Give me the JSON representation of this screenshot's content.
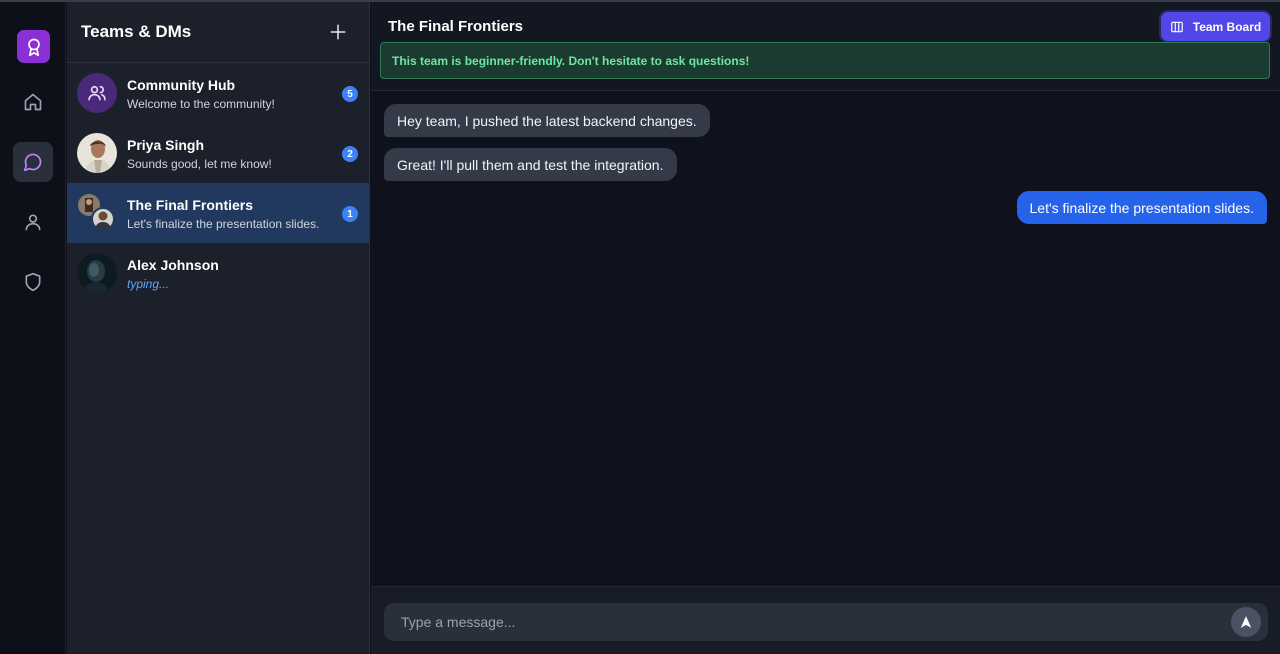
{
  "sidebar_rail": {
    "logo_icon": "award-icon",
    "items": [
      {
        "name": "home",
        "icon": "home-icon",
        "active": false
      },
      {
        "name": "chats",
        "icon": "chat-bubble-icon",
        "active": true
      },
      {
        "name": "profile",
        "icon": "user-icon",
        "active": false
      },
      {
        "name": "security",
        "icon": "shield-icon",
        "active": false
      }
    ]
  },
  "conversations": {
    "title": "Teams & DMs",
    "add_icon": "plus-icon",
    "items": [
      {
        "name": "Community Hub",
        "preview": "Welcome to the community!",
        "unread": "5",
        "active": false
      },
      {
        "name": "Priya Singh",
        "preview": "Sounds good, let me know!",
        "unread": "2",
        "active": false
      },
      {
        "name": "The Final Frontiers",
        "preview": "Let's finalize the presentation slides.",
        "unread": "1",
        "active": true
      },
      {
        "name": "Alex Johnson",
        "preview": "typing...",
        "unread": "",
        "active": false
      }
    ]
  },
  "chat": {
    "title": "The Final Frontiers",
    "team_board_label": "Team Board",
    "notice": "This team is beginner-friendly. Don't hesitate to ask questions!",
    "messages": [
      {
        "direction": "in",
        "text": "Hey team, I pushed the latest backend changes."
      },
      {
        "direction": "in",
        "text": "Great! I'll pull them and test the integration."
      },
      {
        "direction": "out",
        "text": "Let's finalize the presentation slides."
      }
    ],
    "composer": {
      "placeholder": "Type a message...",
      "send_icon": "send-icon"
    }
  },
  "colors": {
    "accent": "#5146e6",
    "logo": "#8b2fd6",
    "outgoing_bubble": "#2563eb",
    "incoming_bubble": "#343a48",
    "badge": "#3b82f6",
    "notice_text": "#6ee7a0"
  }
}
